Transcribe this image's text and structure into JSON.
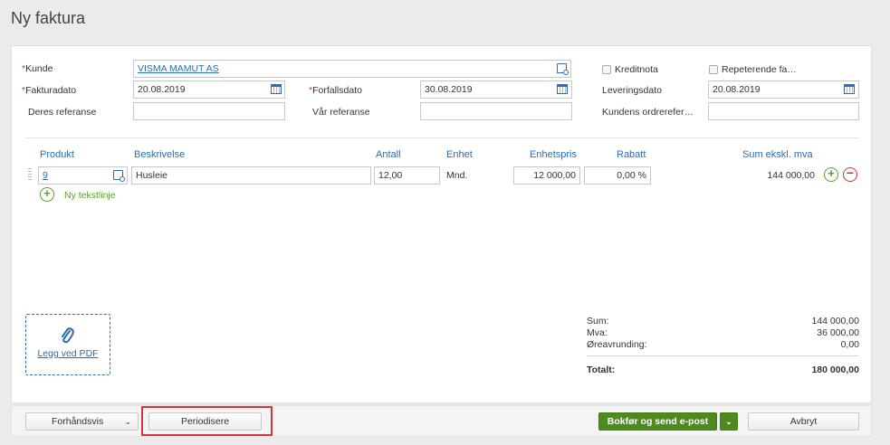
{
  "page": {
    "title": "Ny faktura"
  },
  "form": {
    "kunde": {
      "label": "Kunde",
      "value": "VISMA MAMUT AS"
    },
    "fakturadato": {
      "label": "Fakturadato",
      "value": "20.08.2019"
    },
    "forfallsdato": {
      "label": "Forfallsdato",
      "value": "30.08.2019"
    },
    "deres_referanse": {
      "label": "Deres referanse",
      "value": ""
    },
    "var_referanse": {
      "label": "Vår referanse",
      "value": ""
    },
    "kreditnota": {
      "label": "Kreditnota",
      "checked": false
    },
    "repeterende": {
      "label": "Repeterende fa…",
      "checked": false
    },
    "leveringsdato": {
      "label": "Leveringsdato",
      "value": "20.08.2019"
    },
    "kundens_ordreref": {
      "label": "Kundens ordrerefer…",
      "value": ""
    },
    "required_marker": "*"
  },
  "lines": {
    "columns": {
      "produkt": "Produkt",
      "beskrivelse": "Beskrivelse",
      "antall": "Antall",
      "enhet": "Enhet",
      "enhetspris": "Enhetspris",
      "rabatt": "Rabatt",
      "sum": "Sum ekskl. mva"
    },
    "rows": [
      {
        "produkt": "9",
        "beskrivelse": "Husleie",
        "antall": "12,00",
        "enhet": "Mnd.",
        "enhetspris": "12 000,00",
        "rabatt": "0,00 %",
        "sum": "144 000,00"
      }
    ],
    "add_text_line": "Ny tekstlinje"
  },
  "attachment": {
    "label": "Legg ved PDF",
    "icon": "paperclip-icon"
  },
  "totals": {
    "sum": {
      "label": "Sum:",
      "value": "144 000,00"
    },
    "mva": {
      "label": "Mva:",
      "value": "36 000,00"
    },
    "oreavrunding": {
      "label": "Øreavrunding:",
      "value": "0,00"
    },
    "totalt": {
      "label": "Totalt:",
      "value": "180 000,00"
    }
  },
  "footer": {
    "preview": "Forhåndsvis",
    "periodise": "Periodisere",
    "book_send": "Bokfør og send e-post",
    "cancel": "Avbryt"
  },
  "colors": {
    "accent": "#2a6db0",
    "green": "#4e8a1e",
    "highlight": "#d9343e",
    "danger": "#c0392b"
  }
}
